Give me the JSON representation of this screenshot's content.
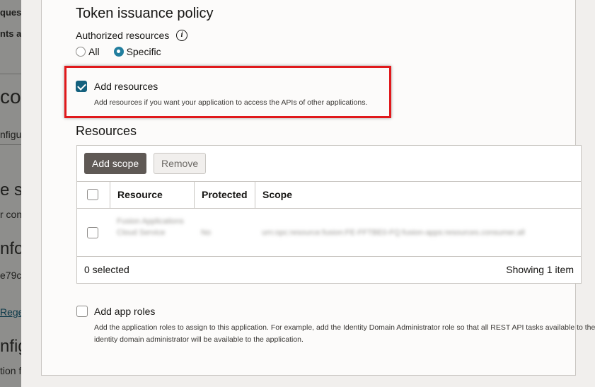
{
  "background": {
    "fragments": [
      "ques",
      "nts a",
      "con",
      "nfigu",
      "e se",
      "r con",
      "nfo",
      "e79c",
      "Rege",
      "nfig",
      "tion f"
    ]
  },
  "policy": {
    "title": "Token issuance policy",
    "authorized_resources_label": "Authorized resources",
    "info_icon": "i",
    "radio_all": "All",
    "radio_specific": "Specific",
    "selected_radio": "Specific"
  },
  "add_resources": {
    "checked": true,
    "label": "Add resources",
    "help": "Add resources if you want your application to access the APIs of other applications."
  },
  "resources": {
    "title": "Resources",
    "add_scope_button": "Add scope",
    "remove_button": "Remove",
    "columns": [
      "Resource",
      "Protected",
      "Scope"
    ],
    "rows": [
      {
        "resource": "Fusion Applications Cloud Service",
        "protected": "No",
        "scope": "urn:opc:resource:fusion:FE-FFTBE0-FQ:fusion-apps:resources.consumer.all"
      }
    ],
    "selected_count": "0 selected",
    "showing": "Showing 1 item"
  },
  "app_roles": {
    "checked": false,
    "label": "Add app roles",
    "help": "Add the application roles to assign to this application. For example, add the Identity Domain Administrator role so that all REST API tasks available to the identity domain administrator will be available to the application."
  },
  "colors": {
    "highlight": "#e0191c",
    "accent": "#227e9e",
    "checkbox_checked": "#14617e"
  }
}
